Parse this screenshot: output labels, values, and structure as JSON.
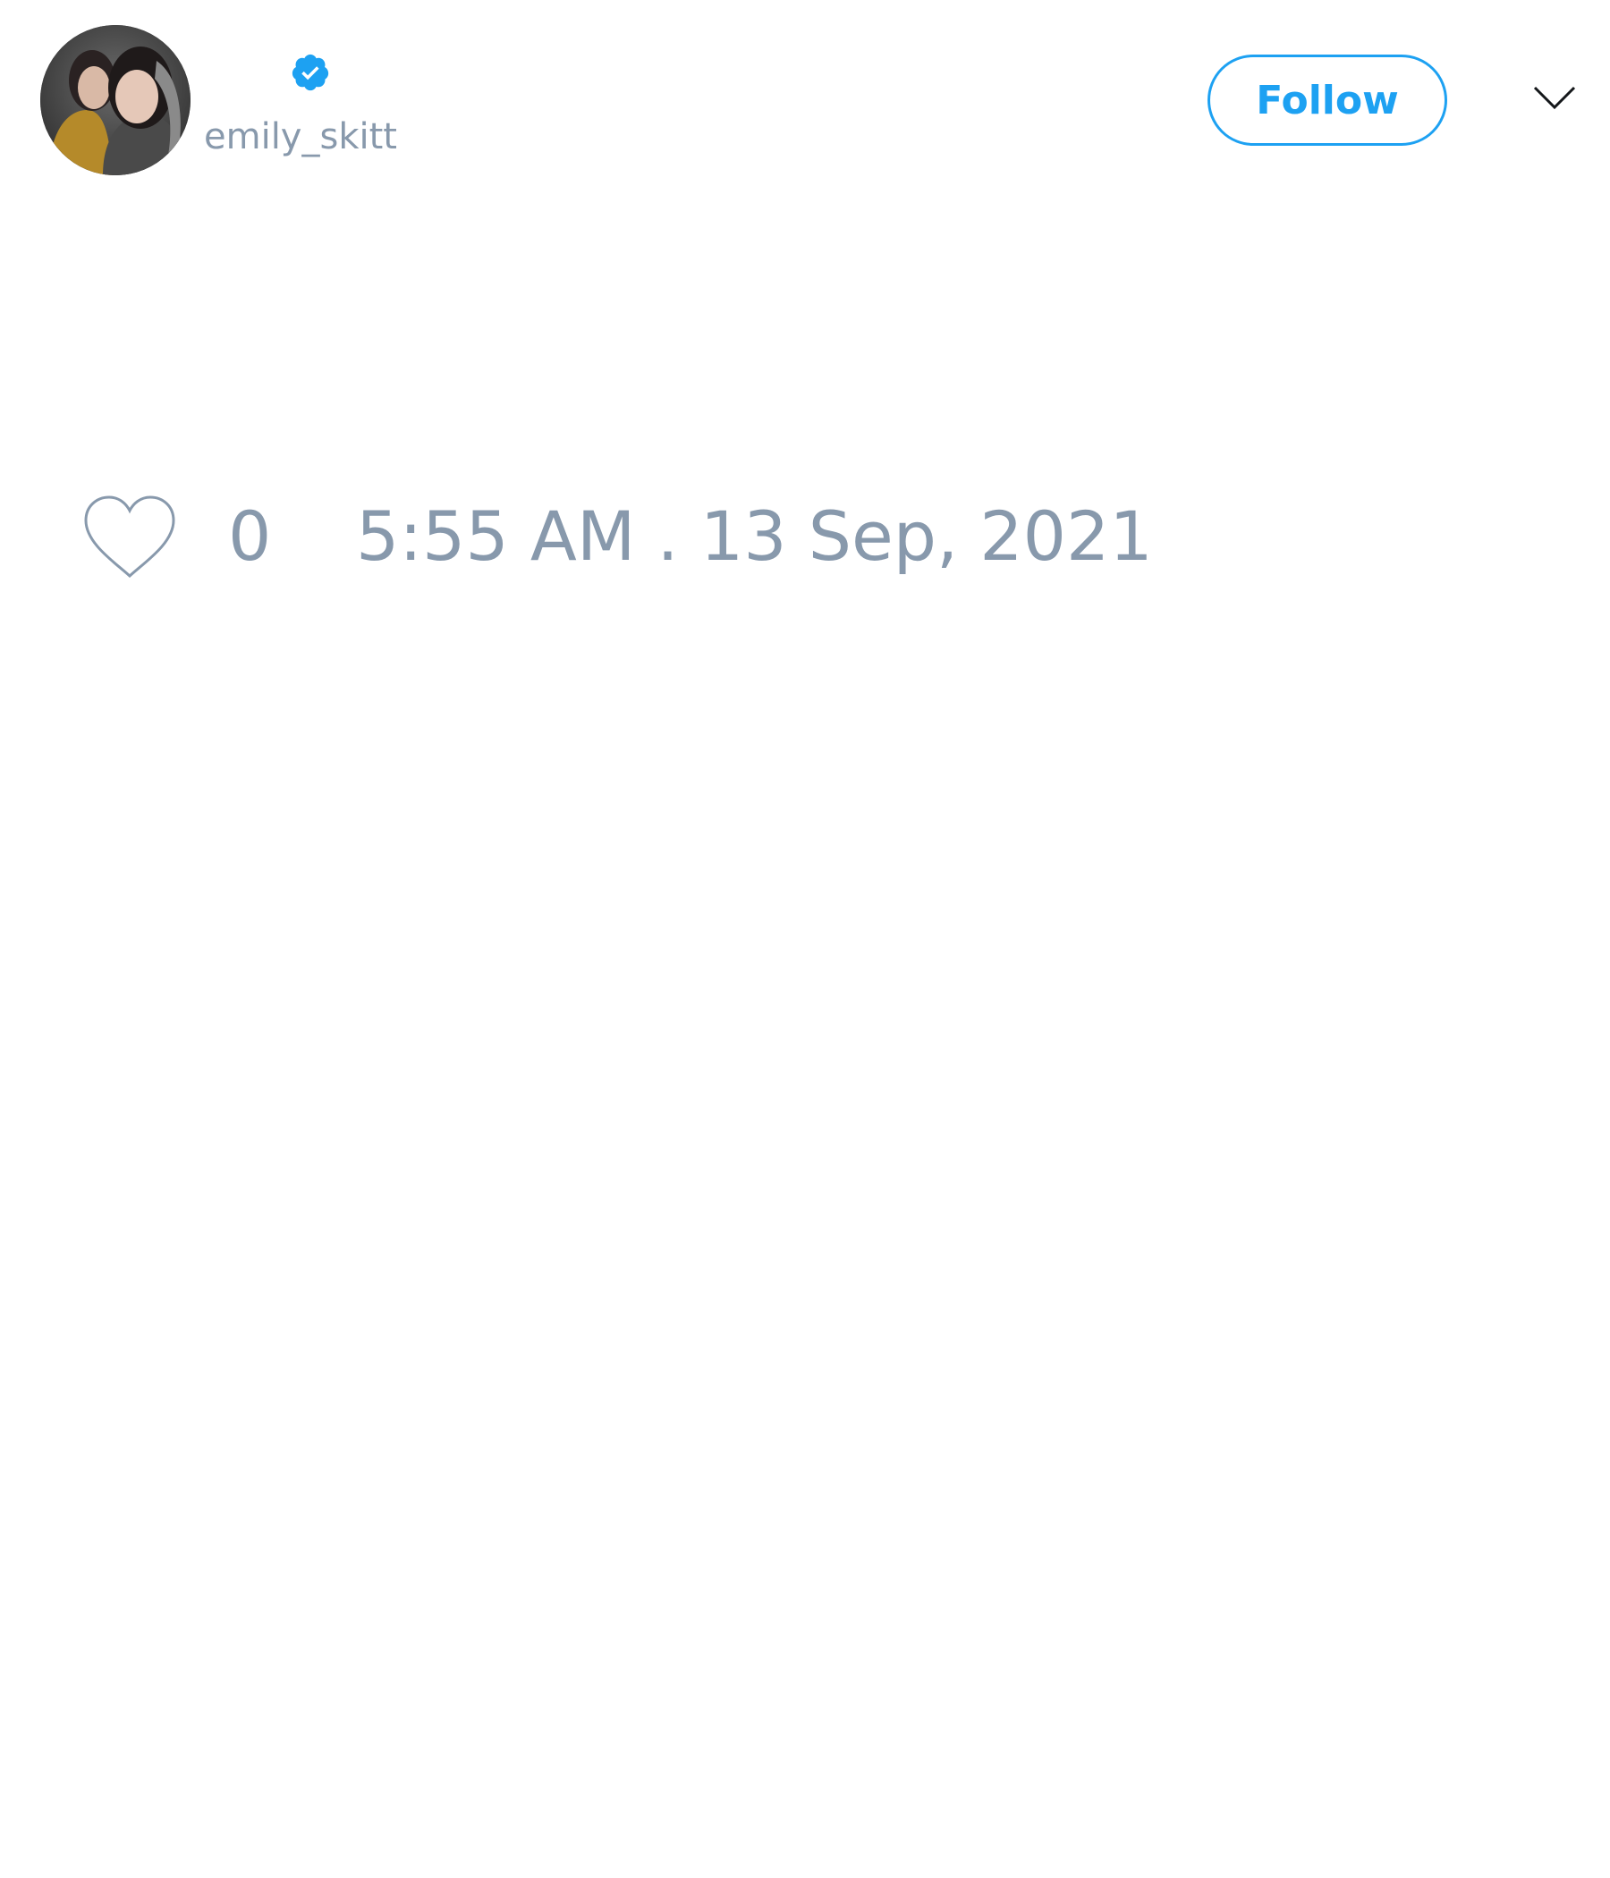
{
  "tweet": {
    "author": {
      "handle": "emily_skitt",
      "verified": true,
      "avatar_icon": "profile-photo"
    },
    "follow_label": "Follow",
    "menu_icon": "chevron-down-icon",
    "like_icon": "heart-outline-icon",
    "like_count": "0",
    "timestamp": "5:55 AM . 13 Sep, 2021"
  },
  "colors": {
    "accent": "#1da1f2",
    "muted_text": "#8899ac",
    "background": "#ffffff"
  }
}
